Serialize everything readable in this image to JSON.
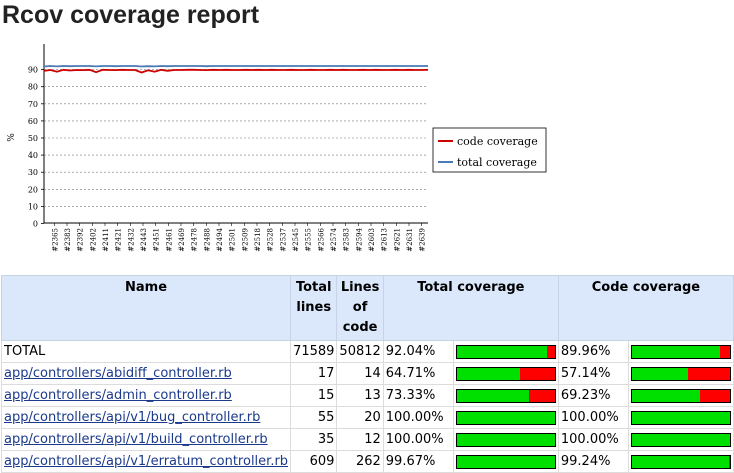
{
  "title": "Rcov coverage report",
  "colors": {
    "code": "#cc0000",
    "total": "#4a79b5",
    "covered": "#00e000",
    "uncovered": "#ff0000",
    "header_bg": "#dbe8fc"
  },
  "chart_data": {
    "type": "line",
    "ylabel": "%",
    "ylim": [
      0,
      100
    ],
    "yticks": [
      0,
      10,
      20,
      30,
      40,
      50,
      60,
      70,
      80,
      90
    ],
    "grid": true,
    "legend_position": "right",
    "xtick_labels": [
      "#2365",
      "#2383",
      "#2392",
      "#2402",
      "#2411",
      "#2421",
      "#2432",
      "#2443",
      "#2451",
      "#2461",
      "#2469",
      "#2478",
      "#2488",
      "#2494",
      "#2501",
      "#2509",
      "#2518",
      "#2528",
      "#2537",
      "#2545",
      "#2555",
      "#2566",
      "#2574",
      "#2583",
      "#2594",
      "#2603",
      "#2613",
      "#2621",
      "#2631",
      "#2639"
    ],
    "series": [
      {
        "name": "code coverage",
        "color": "#cc0000",
        "values": [
          89,
          89.5,
          88.5,
          89.6,
          89.2,
          89.5,
          89.4,
          89.6,
          88.2,
          89.6,
          89.5,
          89.4,
          89.6,
          89.5,
          89.5,
          88.0,
          89.3,
          88.5,
          89.6,
          89.0,
          89.5,
          89.5,
          89.6,
          89.6,
          89.5,
          89.4,
          89.6,
          89.5,
          89.6,
          89.5,
          89.5,
          89.6,
          89.5,
          89.6,
          89.5,
          89.6,
          89.5,
          89.5,
          89.6,
          89.5,
          89.5,
          89.6,
          89.5,
          89.5,
          89.6,
          89.5,
          89.6,
          89.5,
          89.5,
          89.6,
          89.5,
          89.6,
          89.5,
          89.5,
          89.6,
          89.5,
          89.6,
          89.5,
          89.5,
          89.6
        ]
      },
      {
        "name": "total coverage",
        "color": "#4a79b5",
        "values": [
          91.5,
          91.8,
          91.6,
          91.8,
          91.7,
          91.8,
          91.8,
          91.8,
          91.6,
          91.8,
          91.8,
          91.7,
          91.8,
          91.8,
          91.8,
          91.5,
          91.7,
          91.6,
          91.8,
          91.7,
          91.8,
          91.8,
          91.8,
          91.8,
          91.8,
          91.7,
          91.8,
          91.8,
          91.8,
          91.8,
          91.8,
          91.8,
          91.8,
          91.8,
          91.8,
          91.8,
          91.8,
          91.8,
          91.8,
          91.8,
          91.8,
          91.8,
          91.8,
          91.8,
          91.8,
          91.8,
          91.8,
          91.8,
          91.8,
          91.8,
          91.8,
          91.8,
          91.8,
          91.8,
          91.8,
          91.8,
          91.8,
          91.8,
          91.8,
          91.8
        ]
      }
    ]
  },
  "table": {
    "headers": {
      "name": "Name",
      "total_lines": "Total lines",
      "lines_of_code": "Lines of code",
      "total_coverage": "Total coverage",
      "code_coverage": "Code coverage"
    },
    "rows": [
      {
        "name": "TOTAL",
        "link": false,
        "total_lines": "71589",
        "lines_of_code": "50812",
        "total_pct": "92.04%",
        "total_frac": 0.9204,
        "code_pct": "89.96%",
        "code_frac": 0.8996
      },
      {
        "name": "app/controllers/abidiff_controller.rb",
        "link": true,
        "total_lines": "17",
        "lines_of_code": "14",
        "total_pct": "64.71%",
        "total_frac": 0.6471,
        "code_pct": "57.14%",
        "code_frac": 0.5714
      },
      {
        "name": "app/controllers/admin_controller.rb",
        "link": true,
        "total_lines": "15",
        "lines_of_code": "13",
        "total_pct": "73.33%",
        "total_frac": 0.7333,
        "code_pct": "69.23%",
        "code_frac": 0.6923
      },
      {
        "name": "app/controllers/api/v1/bug_controller.rb",
        "link": true,
        "total_lines": "55",
        "lines_of_code": "20",
        "total_pct": "100.00%",
        "total_frac": 1.0,
        "code_pct": "100.00%",
        "code_frac": 1.0
      },
      {
        "name": "app/controllers/api/v1/build_controller.rb",
        "link": true,
        "total_lines": "35",
        "lines_of_code": "12",
        "total_pct": "100.00%",
        "total_frac": 1.0,
        "code_pct": "100.00%",
        "code_frac": 1.0
      },
      {
        "name": "app/controllers/api/v1/erratum_controller.rb",
        "link": true,
        "total_lines": "609",
        "lines_of_code": "262",
        "total_pct": "99.67%",
        "total_frac": 0.9967,
        "code_pct": "99.24%",
        "code_frac": 0.9924
      }
    ]
  }
}
